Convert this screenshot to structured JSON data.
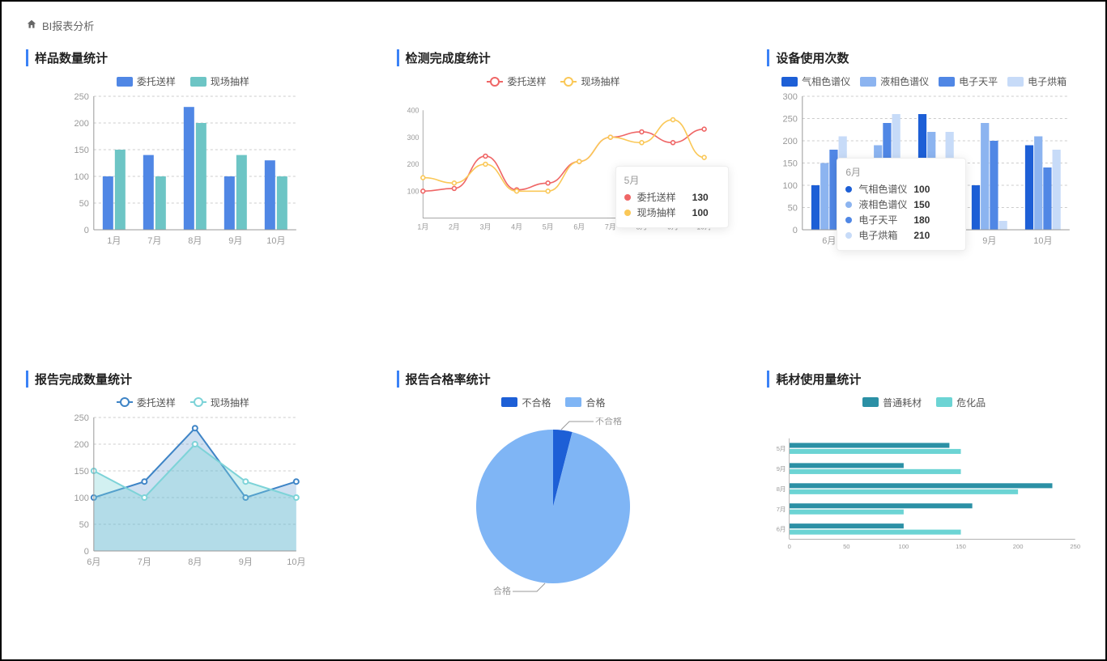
{
  "breadcrumb": "BI报表分析",
  "titles": {
    "c1": "样品数量统计",
    "c2": "检测完成度统计",
    "c3": "设备使用次数",
    "c4": "报告完成数量统计",
    "c5": "报告合格率统计",
    "c6": "耗材使用量统计"
  },
  "legends": {
    "wtss": "委托送样",
    "xccy": "现场抽样",
    "qxsp": "气相色谱仪",
    "yxsp": "液相色谱仪",
    "dztp": "电子天平",
    "dzhx": "电子烘箱",
    "bhg": "不合格",
    "hg": "合格",
    "pthc": "普通耗材",
    "whp": "危化品"
  },
  "chart_data": [
    {
      "id": "c1",
      "type": "bar",
      "categories": [
        "1月",
        "7月",
        "8月",
        "9月",
        "10月"
      ],
      "series": [
        {
          "name": "委托送样",
          "values": [
            100,
            140,
            230,
            100,
            130
          ]
        },
        {
          "name": "现场抽样",
          "values": [
            150,
            100,
            200,
            140,
            100
          ]
        }
      ],
      "ylim": [
        0,
        250
      ],
      "yticks": [
        0,
        50,
        100,
        150,
        200,
        250
      ]
    },
    {
      "id": "c2",
      "type": "line",
      "categories": [
        "1月",
        "2月",
        "3月",
        "4月",
        "5月",
        "6月",
        "7月",
        "8月",
        "9月",
        "10月"
      ],
      "series": [
        {
          "name": "委托送样",
          "values": [
            100,
            110,
            230,
            105,
            130,
            210,
            300,
            320,
            280,
            330
          ]
        },
        {
          "name": "现场抽样",
          "values": [
            150,
            130,
            200,
            100,
            100,
            210,
            300,
            280,
            365,
            225
          ]
        }
      ],
      "ylim": [
        0,
        400
      ],
      "yticks": [
        100,
        200,
        300,
        400
      ],
      "tooltip": {
        "month": "5月",
        "rows": [
          {
            "name": "委托送样",
            "value": 130,
            "color": "#EF6666"
          },
          {
            "name": "现场抽样",
            "value": 100,
            "color": "#FAC858"
          }
        ]
      }
    },
    {
      "id": "c3",
      "type": "bar",
      "categories": [
        "6月",
        "7月",
        "8月",
        "9月",
        "10月"
      ],
      "series": [
        {
          "name": "气相色谱仪",
          "values": [
            100,
            150,
            260,
            100,
            190
          ]
        },
        {
          "name": "液相色谱仪",
          "values": [
            150,
            190,
            220,
            240,
            210
          ]
        },
        {
          "name": "电子天平",
          "values": [
            180,
            240,
            140,
            200,
            140
          ]
        },
        {
          "name": "电子烘箱",
          "values": [
            210,
            260,
            220,
            20,
            180
          ]
        }
      ],
      "ylim": [
        0,
        300
      ],
      "yticks": [
        0,
        50,
        100,
        150,
        200,
        250,
        300
      ],
      "tooltip": {
        "month": "6月",
        "rows": [
          {
            "name": "气相色谱仪",
            "value": 100,
            "color": "#1D5FD6"
          },
          {
            "name": "液相色谱仪",
            "value": 150,
            "color": "#8CB4F0"
          },
          {
            "name": "电子天平",
            "value": 180,
            "color": "#5087E5"
          },
          {
            "name": "电子烘箱",
            "value": 210,
            "color": "#C7DBF8"
          }
        ]
      }
    },
    {
      "id": "c4",
      "type": "area",
      "categories": [
        "6月",
        "7月",
        "8月",
        "9月",
        "10月"
      ],
      "series": [
        {
          "name": "委托送样",
          "values": [
            100,
            130,
            230,
            100,
            130
          ]
        },
        {
          "name": "现场抽样",
          "values": [
            150,
            100,
            200,
            130,
            100
          ]
        }
      ],
      "ylim": [
        0,
        250
      ],
      "yticks": [
        0,
        50,
        100,
        150,
        200,
        250
      ]
    },
    {
      "id": "c5",
      "type": "pie",
      "series": [
        {
          "name": "不合格",
          "value": 4,
          "color": "#1D5FD6"
        },
        {
          "name": "合格",
          "value": 96,
          "color": "#7FB5F5"
        }
      ],
      "labels": {
        "bhg": "不合格",
        "hg": "合格"
      }
    },
    {
      "id": "c6",
      "type": "bar-horizontal",
      "categories": [
        "5月",
        "9月",
        "8月",
        "7月",
        "6月"
      ],
      "series": [
        {
          "name": "普通耗材",
          "values": [
            140,
            100,
            230,
            160,
            100
          ]
        },
        {
          "name": "危化品",
          "values": [
            150,
            150,
            200,
            100,
            150
          ]
        }
      ],
      "xlim": [
        0,
        250
      ],
      "xticks": [
        0,
        50,
        100,
        150,
        200,
        250
      ]
    }
  ]
}
